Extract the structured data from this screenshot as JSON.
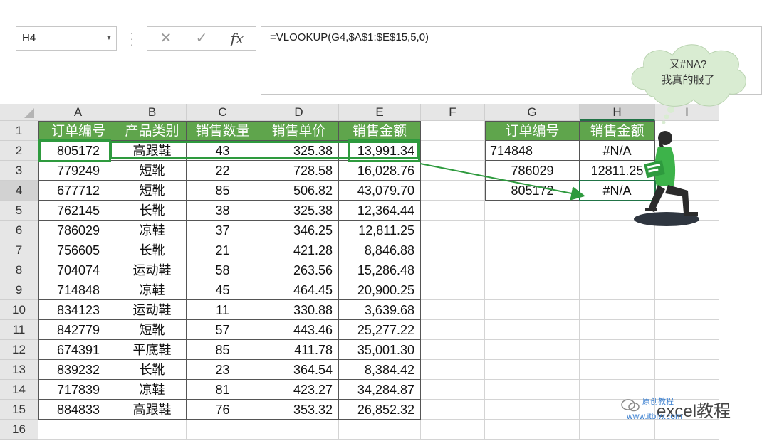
{
  "name_box": "H4",
  "formula_bar": {
    "cancel_icon": "✕",
    "enter_icon": "✓",
    "fx_label": "fx",
    "formula": "=VLOOKUP(G4,$A$1:$E$15,5,0)"
  },
  "columns": [
    "A",
    "B",
    "C",
    "D",
    "E",
    "F",
    "G",
    "H",
    "I"
  ],
  "rows": [
    "1",
    "2",
    "3",
    "4",
    "5",
    "6",
    "7",
    "8",
    "9",
    "10",
    "11",
    "12",
    "13",
    "14",
    "15",
    "16"
  ],
  "main_table": {
    "headers": [
      "订单编号",
      "产品类别",
      "销售数量",
      "销售单价",
      "销售金额"
    ],
    "rows": [
      [
        "805172",
        "高跟鞋",
        "43",
        "325.38",
        "13,991.34"
      ],
      [
        "779249",
        "短靴",
        "22",
        "728.58",
        "16,028.76"
      ],
      [
        "677712",
        "短靴",
        "85",
        "506.82",
        "43,079.70"
      ],
      [
        "762145",
        "长靴",
        "38",
        "325.38",
        "12,364.44"
      ],
      [
        "786029",
        "凉鞋",
        "37",
        "346.25",
        "12,811.25"
      ],
      [
        "756605",
        "长靴",
        "21",
        "421.28",
        "8,846.88"
      ],
      [
        "704074",
        "运动鞋",
        "58",
        "263.56",
        "15,286.48"
      ],
      [
        "714848",
        "凉鞋",
        "45",
        "464.45",
        "20,900.25"
      ],
      [
        "834123",
        "运动鞋",
        "11",
        "330.88",
        "3,639.68"
      ],
      [
        "842779",
        "短靴",
        "57",
        "443.46",
        "25,277.22"
      ],
      [
        "674391",
        "平底鞋",
        "85",
        "411.78",
        "35,001.30"
      ],
      [
        "839232",
        "长靴",
        "23",
        "364.54",
        "8,384.42"
      ],
      [
        "717839",
        "凉鞋",
        "81",
        "423.27",
        "34,284.87"
      ],
      [
        "884833",
        "高跟鞋",
        "76",
        "353.32",
        "26,852.32"
      ]
    ]
  },
  "lookup_table": {
    "headers": [
      "订单编号",
      "销售金额"
    ],
    "rows": [
      [
        "714848",
        "#N/A"
      ],
      [
        "786029",
        "12811.25"
      ],
      [
        "805172",
        "#N/A"
      ]
    ]
  },
  "bubble": {
    "line1": "又#NA?",
    "line2": "我真的服了"
  },
  "watermark": {
    "line1": "excel教程",
    "small": "原创教程",
    "url": "www.itblw.com"
  },
  "colors": {
    "header_green": "#5fa54c",
    "highlight_green": "#2e9a3e",
    "arrow_green": "#2e9a3e"
  }
}
